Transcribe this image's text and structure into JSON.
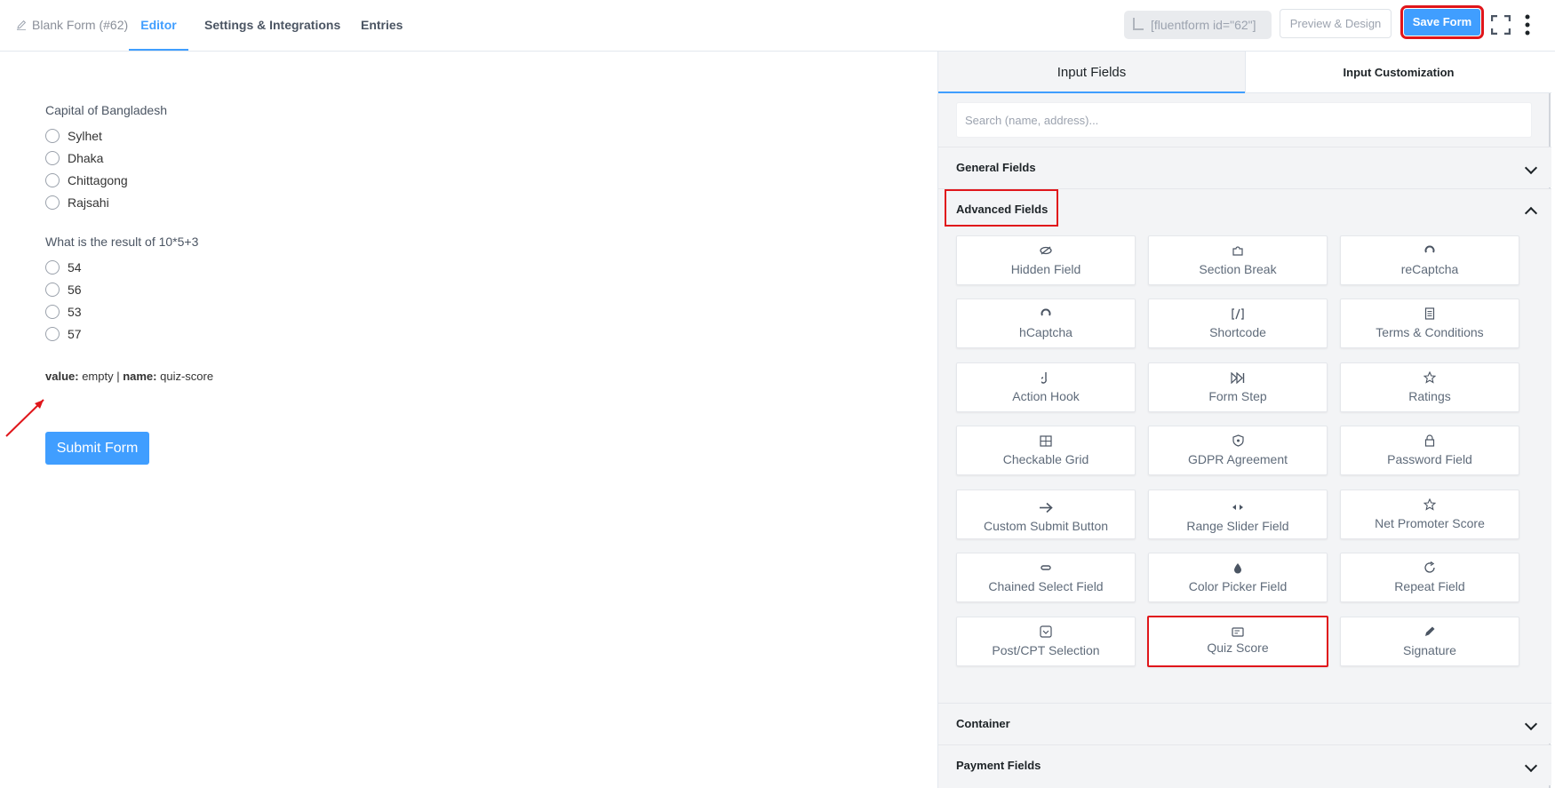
{
  "header": {
    "breadcrumb": "Blank Form (#62)",
    "tabs": [
      {
        "label": "Editor",
        "active": true
      },
      {
        "label": "Settings & Integrations",
        "active": false
      },
      {
        "label": "Entries",
        "active": false
      }
    ],
    "shortcode": "[fluentform id=\"62\"]",
    "preview_label": "Preview & Design",
    "save_label": "Save Form"
  },
  "form": {
    "questions": [
      {
        "label": "Capital of Bangladesh",
        "options": [
          "Sylhet",
          "Dhaka",
          "Chittagong",
          "Rajsahi"
        ]
      },
      {
        "label": "What is the result of 10*5+3",
        "options": [
          "54",
          "56",
          "53",
          "57"
        ]
      }
    ],
    "score": {
      "value_key": "value:",
      "value": " empty | ",
      "name_key": "name:",
      "name": " quiz-score"
    },
    "submit_label": "Submit Form"
  },
  "panel": {
    "tabs": [
      {
        "label": "Input Fields",
        "active": true
      },
      {
        "label": "Input Customization",
        "active": false
      }
    ],
    "search_placeholder": "Search (name, address)...",
    "sections": {
      "general": "General Fields",
      "advanced": "Advanced Fields",
      "container": "Container",
      "payment": "Payment Fields"
    },
    "advanced_fields": [
      {
        "label": "Hidden Field",
        "icon": "eye-slash-icon"
      },
      {
        "label": "Section Break",
        "icon": "puzzle-icon"
      },
      {
        "label": "reCaptcha",
        "icon": "recaptcha-icon"
      },
      {
        "label": "hCaptcha",
        "icon": "hcaptcha-icon"
      },
      {
        "label": "Shortcode",
        "icon": "shortcode-icon"
      },
      {
        "label": "Terms & Conditions",
        "icon": "document-icon"
      },
      {
        "label": "Action Hook",
        "icon": "hook-icon"
      },
      {
        "label": "Form Step",
        "icon": "step-forward-icon"
      },
      {
        "label": "Ratings",
        "icon": "star-icon"
      },
      {
        "label": "Checkable Grid",
        "icon": "grid-icon"
      },
      {
        "label": "GDPR Agreement",
        "icon": "shield-icon"
      },
      {
        "label": "Password Field",
        "icon": "lock-icon"
      },
      {
        "label": "Custom Submit Button",
        "icon": "arrow-right-icon"
      },
      {
        "label": "Range Slider Field",
        "icon": "range-icon"
      },
      {
        "label": "Net Promoter Score",
        "icon": "star-icon"
      },
      {
        "label": "Chained Select Field",
        "icon": "link-icon"
      },
      {
        "label": "Color Picker Field",
        "icon": "droplet-icon"
      },
      {
        "label": "Repeat Field",
        "icon": "repeat-icon"
      },
      {
        "label": "Post/CPT Selection",
        "icon": "post-select-icon"
      },
      {
        "label": "Quiz Score",
        "icon": "quiz-icon"
      },
      {
        "label": "Signature",
        "icon": "pen-icon"
      }
    ]
  },
  "colors": {
    "accent": "#409eff",
    "highlight": "#e0161b"
  }
}
